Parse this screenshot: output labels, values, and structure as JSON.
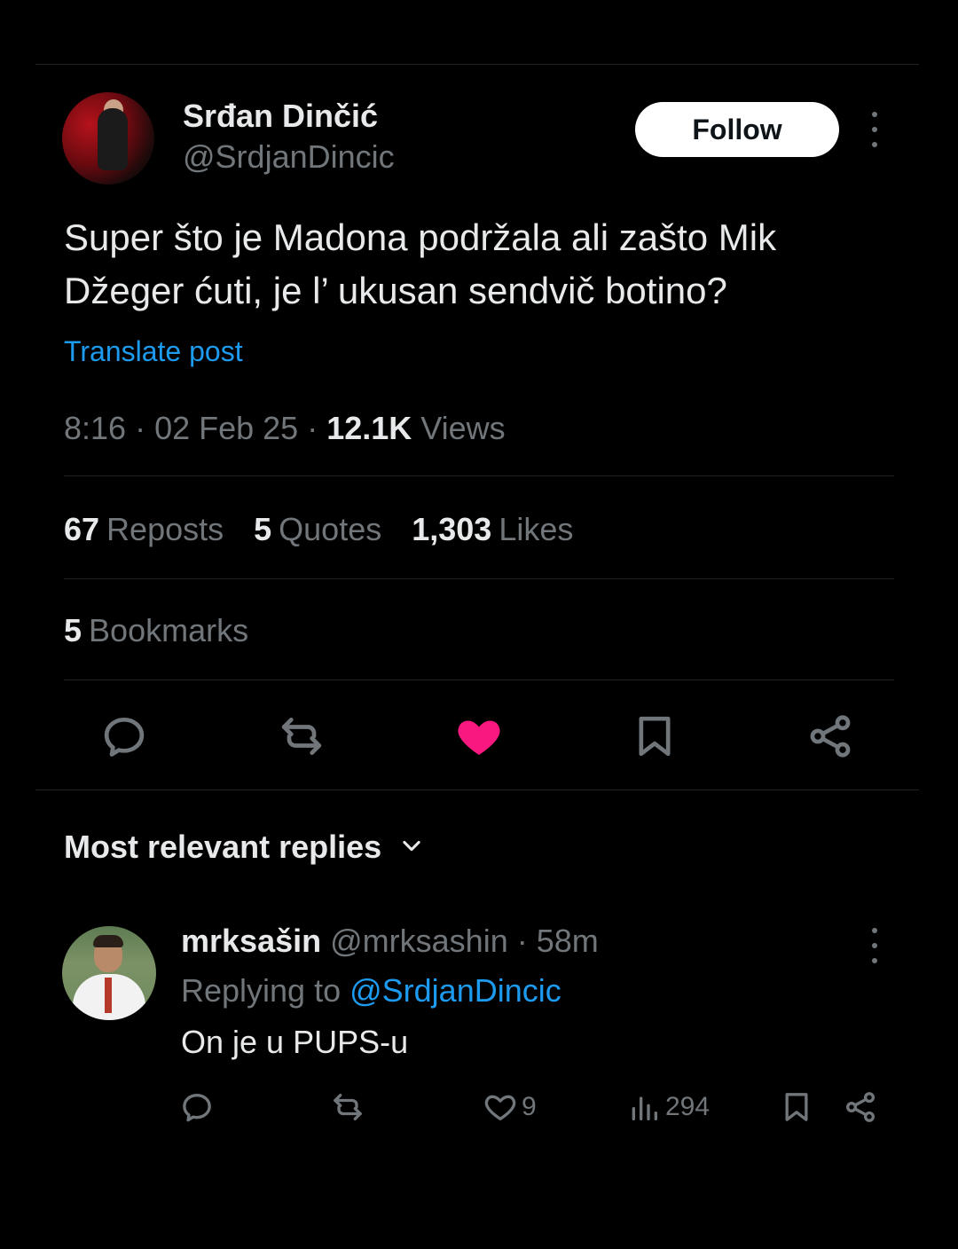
{
  "tweet": {
    "author_name": "Srđan Dinčić",
    "author_handle": "@SrdjanDincic",
    "follow_label": "Follow",
    "text_line1": "Super što je Madona podržala ali zašto Mik",
    "text_line2": "Džeger ćuti, je l’ ukusan sendvič botino?",
    "translate_label": "Translate post",
    "time": "8:16",
    "sep1": " · ",
    "date": "02 Feb 25",
    "sep2": " · ",
    "views_count": "12.1K",
    "views_label": " Views"
  },
  "stats": {
    "reposts_count": "67",
    "reposts_label": "Reposts",
    "quotes_count": "5",
    "quotes_label": "Quotes",
    "likes_count": "1,303",
    "likes_label": "Likes",
    "bookmarks_count": "5",
    "bookmarks_label": "Bookmarks"
  },
  "actions": {
    "icons": [
      "reply-icon",
      "repost-icon",
      "like-icon",
      "bookmark-icon",
      "share-icon"
    ],
    "liked": true,
    "like_color": "#f91880"
  },
  "replies": {
    "sort_label": "Most relevant replies",
    "items": [
      {
        "name": "mrksašin",
        "handle": "@mrksashin",
        "sep": " · ",
        "age": "58m",
        "replying_prefix": "Replying to ",
        "replying_to": "@SrdjanDincic",
        "text": "On je u PUPS-u",
        "likes": "9",
        "views": "294"
      }
    ]
  },
  "colors": {
    "background": "#000000",
    "text_primary": "#e7e9ea",
    "text_secondary": "#71767b",
    "link": "#1d9bf0"
  }
}
